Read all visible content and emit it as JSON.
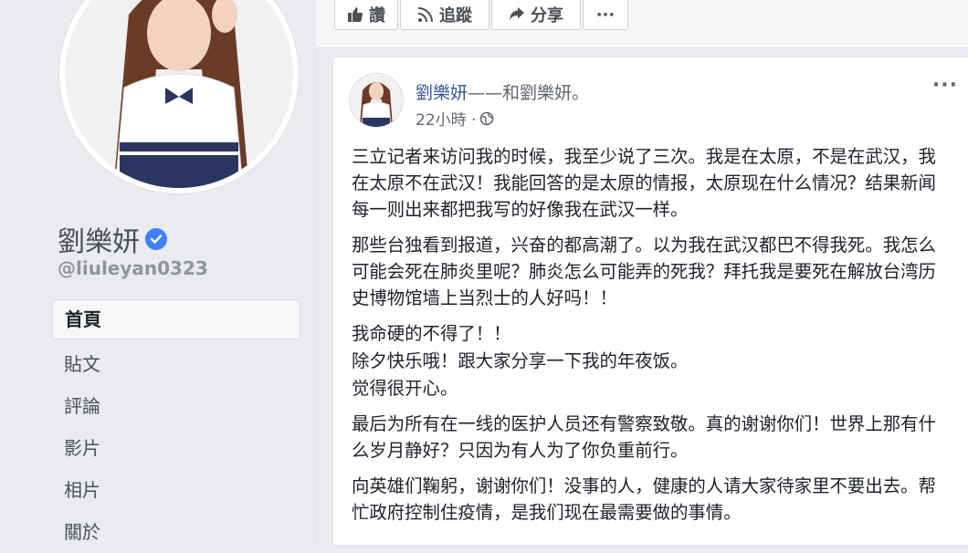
{
  "profile": {
    "name": "劉樂妍",
    "handle": "@liuleyan0323"
  },
  "nav": [
    {
      "label": "首頁"
    },
    {
      "label": "貼文"
    },
    {
      "label": "評論"
    },
    {
      "label": "影片"
    },
    {
      "label": "相片"
    },
    {
      "label": "關於"
    }
  ],
  "actions": {
    "like": "讚",
    "follow": "追蹤",
    "share": "分享",
    "more": "···"
  },
  "post": {
    "author": "劉樂妍",
    "with_text": "——和劉樂妍。",
    "time": "22小時 ·",
    "more": "···",
    "paragraphs": [
      "三立记者来访问我的时候，我至少说了三次。我是在太原，不是在武汉，我在太原不在武汉！我能回答的是太原的情报，太原现在什么情况？结果新闻每一则出来都把我写的好像我在武汉一样。",
      "那些台独看到报道，兴奋的都高潮了。以为我在武汉都巴不得我死。我怎么可能会死在肺炎里呢？肺炎怎么可能弄的死我？拜托我是要死在解放台湾历史博物馆墙上当烈士的人好吗！！",
      "我命硬的不得了！！",
      "除夕快乐哦！跟大家分享一下我的年夜饭。",
      "觉得很开心。",
      "最后为所有在一线的医护人员还有警察致敬。真的谢谢你们！世界上那有什么岁月静好？只因为有人为了你负重前行。",
      "向英雄们鞠躬，谢谢你们！没事的人，健康的人请大家待家里不要出去。帮忙政府控制住疫情，是我们现在最需要做的事情。"
    ]
  },
  "colors": {
    "link": "#385898",
    "verified": "#4080ff",
    "background": "#e9ebee"
  },
  "icons": [
    "thumbs-up-icon",
    "rss-icon",
    "share-arrow-icon",
    "globe-icon",
    "check-icon"
  ]
}
